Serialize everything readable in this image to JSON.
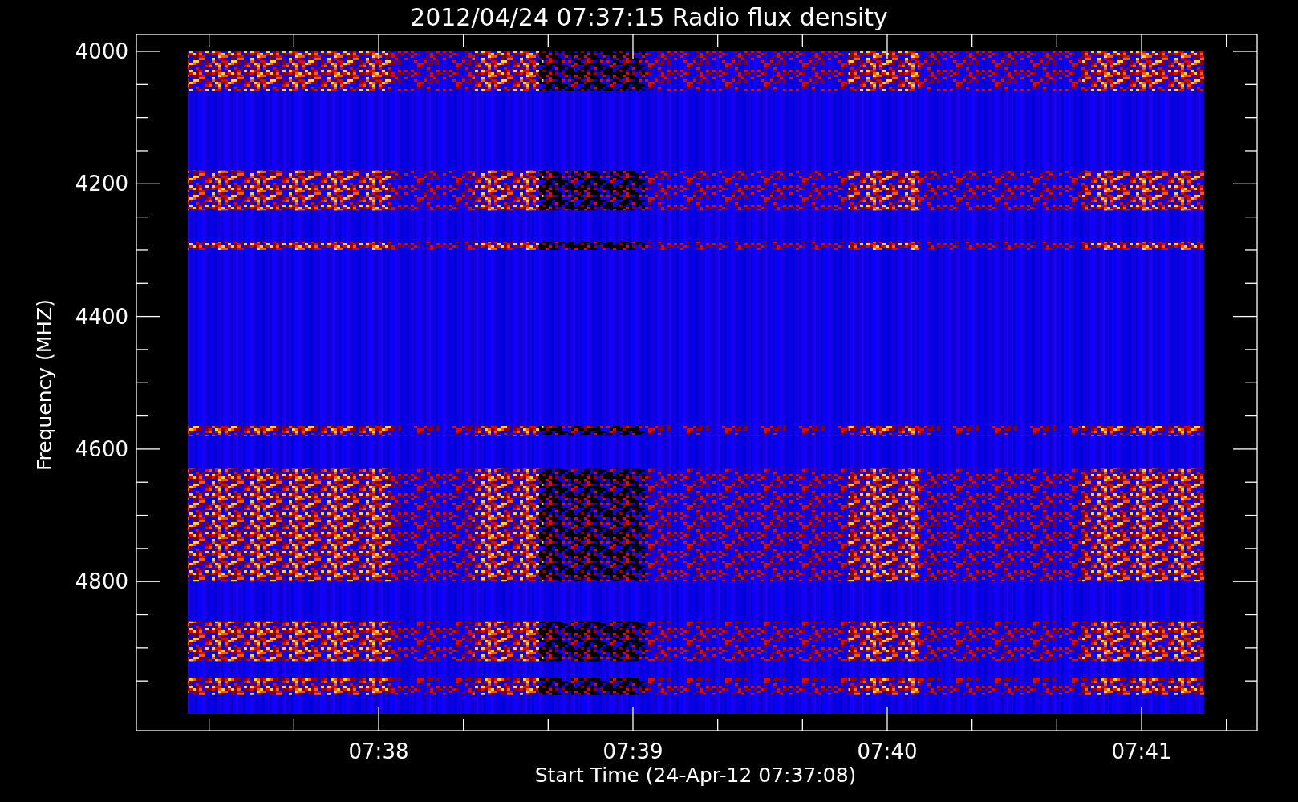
{
  "title": "2012/04/24 07:37:15 Radio flux density",
  "y_axis": {
    "label": "Frequency (MHZ)",
    "ticks": [
      "4000",
      "4200",
      "4400",
      "4600",
      "4800"
    ]
  },
  "x_axis": {
    "label": "Start Time (24-Apr-12 07:37:08)",
    "ticks": [
      "07:38",
      "07:39",
      "07:40",
      "07:41"
    ]
  }
}
